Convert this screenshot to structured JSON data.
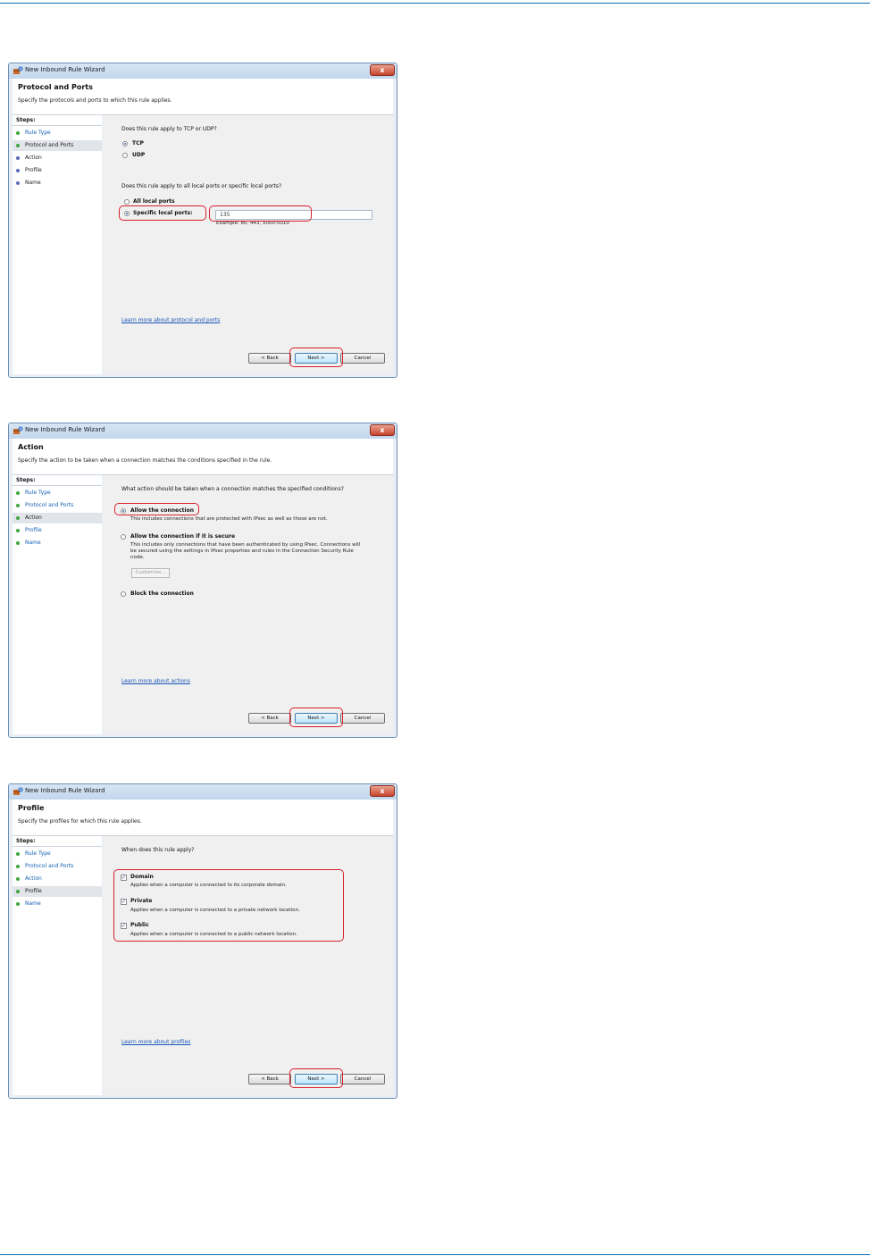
{
  "accent_color": "#0a6fb0",
  "highlight_color": "#d8202e",
  "dialogs": [
    {
      "window_title": "New Inbound Rule Wizard",
      "close_glyph": "x",
      "header_title": "Protocol and Ports",
      "header_subtitle": "Specify the protocols and ports to which this rule applies.",
      "steps_title": "Steps:",
      "steps": [
        "Rule Type",
        "Protocol and Ports",
        "Action",
        "Profile",
        "Name"
      ],
      "current_step": 1,
      "question1": "Does this rule apply to TCP or UDP?",
      "opt_tcp": "TCP",
      "opt_udp": "UDP",
      "question2": "Does this rule apply to all local ports or specific local ports?",
      "opt_all_ports": "All local ports",
      "opt_specific_ports": "Specific local ports:",
      "port_value": "135",
      "port_example": "Example: 80, 443, 5000-5010",
      "learn_more": "Learn more about protocol and ports",
      "back_label": "< Back",
      "next_label": "Next >",
      "cancel_label": "Cancel"
    },
    {
      "window_title": "New Inbound Rule Wizard",
      "close_glyph": "x",
      "header_title": "Action",
      "header_subtitle": "Specify the action to be taken when a connection matches the conditions specified in the rule.",
      "steps_title": "Steps:",
      "steps": [
        "Rule Type",
        "Protocol and Ports",
        "Action",
        "Profile",
        "Name"
      ],
      "current_step": 2,
      "question": "What action should be taken when a connection matches the specified conditions?",
      "opt_allow": "Allow the connection",
      "opt_allow_desc": "This includes connections that are protected with IPsec as well as those are not.",
      "opt_secure": "Allow the connection if it is secure",
      "opt_secure_desc": "This includes only connections that have been authenticated by using IPsec.  Connections will be secured using the settings in IPsec properties and rules in the Connection Security Rule node.",
      "customize_label": "Customize...",
      "opt_block": "Block the connection",
      "learn_more": "Learn more about actions",
      "back_label": "< Back",
      "next_label": "Next >",
      "cancel_label": "Cancel"
    },
    {
      "window_title": "New Inbound Rule Wizard",
      "close_glyph": "x",
      "header_title": "Profile",
      "header_subtitle": "Specify the profiles for which this rule applies.",
      "steps_title": "Steps:",
      "steps": [
        "Rule Type",
        "Protocol and Ports",
        "Action",
        "Profile",
        "Name"
      ],
      "current_step": 3,
      "question": "When does this rule apply?",
      "domain_label": "Domain",
      "domain_desc": "Applies when a computer is connected to its corporate domain.",
      "private_label": "Private",
      "private_desc": "Applies when a computer is connected to a private network location.",
      "public_label": "Public",
      "public_desc": "Applies when a computer is connected to a public network location.",
      "check_glyph": "✓",
      "learn_more": "Learn more about profiles",
      "back_label": "< Back",
      "next_label": "Next >",
      "cancel_label": "Cancel"
    }
  ]
}
